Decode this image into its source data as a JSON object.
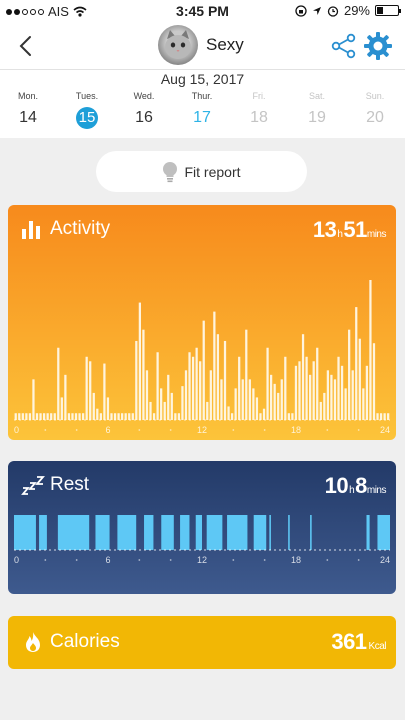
{
  "status_bar": {
    "carrier": "AIS",
    "time": "3:45 PM",
    "battery_percent_label": "29%",
    "battery_level": 0.29
  },
  "header": {
    "profile_name": "Sexy"
  },
  "date_strip": {
    "current_date": "Aug 15, 2017",
    "days": [
      {
        "name": "Mon.",
        "number": "14",
        "state": "past"
      },
      {
        "name": "Tues.",
        "number": "15",
        "state": "selected"
      },
      {
        "name": "Wed.",
        "number": "16",
        "state": "past"
      },
      {
        "name": "Thur.",
        "number": "17",
        "state": "today"
      },
      {
        "name": "Fri.",
        "number": "18",
        "state": "future"
      },
      {
        "name": "Sat.",
        "number": "19",
        "state": "future"
      },
      {
        "name": "Sun.",
        "number": "20",
        "state": "future"
      }
    ]
  },
  "fit_report": {
    "label": "Fit report"
  },
  "activity": {
    "title": "Activity",
    "hours": "13",
    "minutes": "51",
    "unit_hours": "h",
    "unit_minutes": "mins",
    "axis_ticks": [
      "0",
      "6",
      "12",
      "18",
      "24"
    ],
    "levels": [
      3,
      3,
      3,
      3,
      3,
      18,
      3,
      3,
      3,
      3,
      3,
      3,
      32,
      10,
      20,
      3,
      3,
      3,
      3,
      3,
      28,
      26,
      12,
      5,
      3,
      25,
      10,
      3,
      3,
      3,
      3,
      3,
      3,
      3,
      35,
      52,
      40,
      22,
      8,
      3,
      30,
      14,
      8,
      20,
      12,
      3,
      3,
      15,
      22,
      30,
      28,
      32,
      26,
      44,
      8,
      22,
      48,
      38,
      18,
      35,
      6,
      3,
      14,
      28,
      18,
      40,
      18,
      14,
      10,
      3,
      5,
      32,
      20,
      16,
      12,
      18,
      28,
      3,
      3,
      24,
      26,
      38,
      28,
      20,
      26,
      32,
      8,
      12,
      22,
      20,
      18,
      28,
      24,
      14,
      40,
      22,
      50,
      36,
      14,
      24,
      62,
      34,
      3,
      3,
      3,
      3
    ]
  },
  "rest": {
    "title": "Rest",
    "hours": "10",
    "minutes": "8",
    "unit_hours": "h",
    "unit_minutes": "mins",
    "axis_ticks": [
      "0",
      "6",
      "12",
      "18",
      "24"
    ],
    "blocks": [
      [
        0.0,
        1.4
      ],
      [
        1.6,
        2.1
      ],
      [
        2.8,
        4.8
      ],
      [
        5.2,
        6.1
      ],
      [
        6.6,
        7.8
      ],
      [
        8.3,
        8.9
      ],
      [
        9.4,
        10.2
      ],
      [
        10.6,
        11.2
      ],
      [
        11.6,
        12.0
      ],
      [
        12.3,
        13.3
      ],
      [
        13.6,
        14.9
      ],
      [
        15.3,
        16.1
      ],
      [
        16.3,
        16.4
      ],
      [
        17.5,
        17.6
      ],
      [
        18.9,
        19.0
      ],
      [
        22.5,
        22.7
      ],
      [
        23.2,
        24.0
      ]
    ]
  },
  "calories": {
    "title": "Calories",
    "value": "361",
    "unit": "Kcal"
  },
  "colors": {
    "activity_top": "#f78a1c",
    "activity_bottom": "#fcc43a",
    "rest_top": "#233a68",
    "rest_bar": "#5ec8f5",
    "calories": "#f2b705",
    "accent_blue": "#1e9fd8"
  },
  "icons": [
    "back-chevron-icon",
    "share-icon",
    "settings-gear-icon",
    "lightbulb-icon",
    "bar-chart-icon",
    "zzz-icon",
    "flame-icon",
    "wifi-icon",
    "location-arrow-icon",
    "alarm-icon",
    "battery-icon"
  ]
}
